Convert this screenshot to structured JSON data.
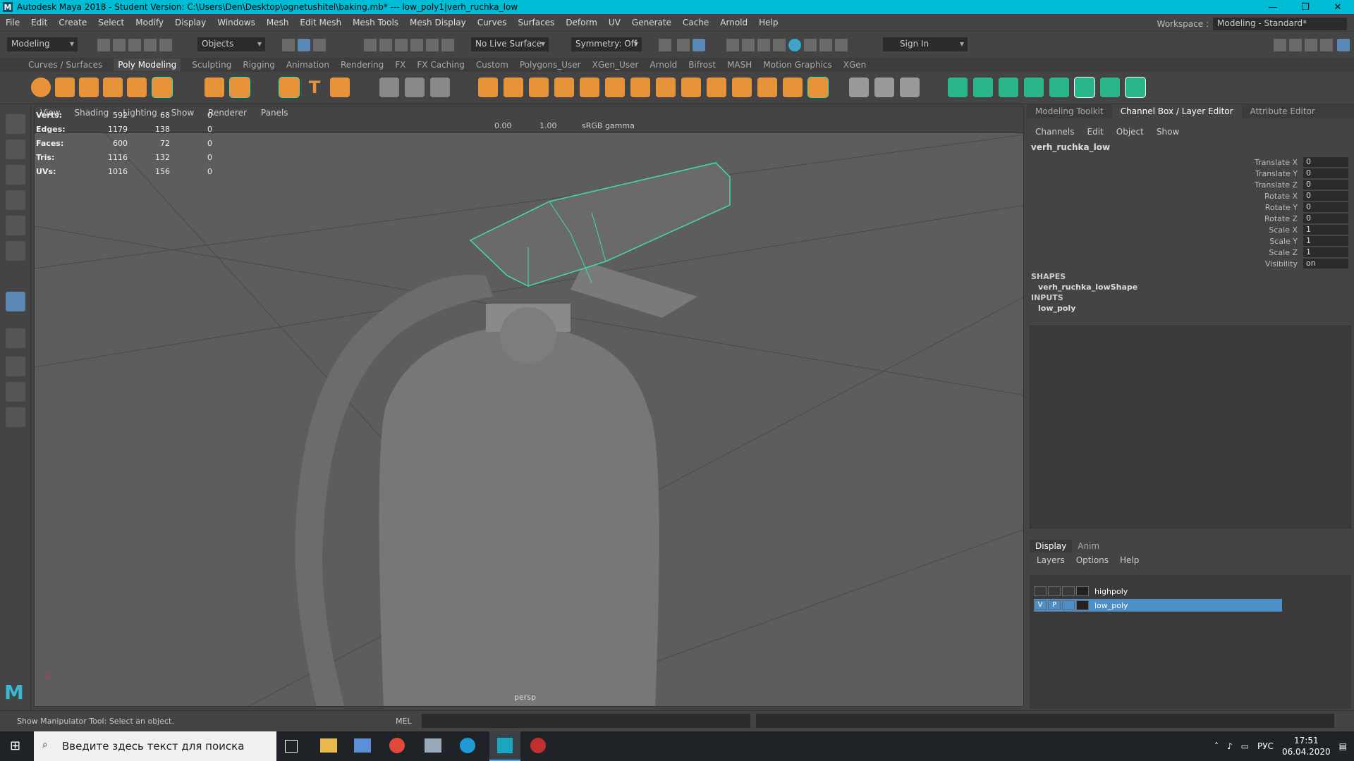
{
  "window": {
    "title": "Autodesk Maya 2018 - Student Version: C:\\Users\\Den\\Desktop\\ognetushitel\\baking.mb*   ---   low_poly1|verh_ruchka_low",
    "logo": "M",
    "controls": [
      "—",
      "❐",
      "✕"
    ]
  },
  "menu": [
    "File",
    "Edit",
    "Create",
    "Select",
    "Modify",
    "Display",
    "Windows",
    "Mesh",
    "Edit Mesh",
    "Mesh Tools",
    "Mesh Display",
    "Curves",
    "Surfaces",
    "Deform",
    "UV",
    "Generate",
    "Cache",
    "Arnold",
    "Help"
  ],
  "workspace": {
    "label": "Workspace :",
    "value": "Modeling - Standard*"
  },
  "statusline": {
    "mode": "Modeling",
    "select_mode": "Objects",
    "live_surface": "No Live Surface",
    "symmetry": "Symmetry: Off",
    "sign_in": "Sign In"
  },
  "shelf_tabs": [
    "Curves / Surfaces",
    "Poly Modeling",
    "Sculpting",
    "Rigging",
    "Animation",
    "Rendering",
    "FX",
    "FX Caching",
    "Custom",
    "Polygons_User",
    "XGen_User",
    "Arnold",
    "Bifrost",
    "MASH",
    "Motion Graphics",
    "XGen"
  ],
  "active_shelf": "Poly Modeling",
  "viewport": {
    "menu": [
      "View",
      "Shading",
      "Lighting",
      "Show",
      "Renderer",
      "Panels"
    ],
    "exposure": "0.00",
    "gamma": "1.00",
    "color_space": "sRGB gamma",
    "camera": "persp",
    "hud": [
      {
        "label": "Verts:",
        "a": "592",
        "b": "68",
        "c": "0"
      },
      {
        "label": "Edges:",
        "a": "1179",
        "b": "138",
        "c": "0"
      },
      {
        "label": "Faces:",
        "a": "600",
        "b": "72",
        "c": "0"
      },
      {
        "label": "Tris:",
        "a": "1116",
        "b": "132",
        "c": "0"
      },
      {
        "label": "UVs:",
        "a": "1016",
        "b": "156",
        "c": "0"
      }
    ]
  },
  "right_panel": {
    "tabs": [
      "Modeling Toolkit",
      "Channel Box / Layer Editor",
      "Attribute Editor"
    ],
    "active_tab": "Channel Box / Layer Editor",
    "channel_menu": [
      "Channels",
      "Edit",
      "Object",
      "Show"
    ],
    "object": "verh_ruchka_low",
    "attributes": [
      {
        "name": "Translate X",
        "value": "0"
      },
      {
        "name": "Translate Y",
        "value": "0"
      },
      {
        "name": "Translate Z",
        "value": "0"
      },
      {
        "name": "Rotate X",
        "value": "0"
      },
      {
        "name": "Rotate Y",
        "value": "0"
      },
      {
        "name": "Rotate Z",
        "value": "0"
      },
      {
        "name": "Scale X",
        "value": "1"
      },
      {
        "name": "Scale Y",
        "value": "1"
      },
      {
        "name": "Scale Z",
        "value": "1"
      },
      {
        "name": "Visibility",
        "value": "on"
      }
    ],
    "shapes_header": "SHAPES",
    "shape": "verh_ruchka_lowShape",
    "inputs_header": "INPUTS",
    "input": "low_poly",
    "layer_tabs": [
      "Display",
      "Anim"
    ],
    "layer_menu": [
      "Layers",
      "Options",
      "Help"
    ],
    "layers": [
      {
        "name": "highpoly",
        "v": "",
        "p": ""
      },
      {
        "name": "low_poly",
        "v": "V",
        "p": "P"
      }
    ]
  },
  "helpline": {
    "message": "Show Manipulator Tool: Select an object.",
    "mel": "MEL"
  },
  "taskbar": {
    "search_placeholder": "Введите здесь текст для поиска",
    "lang": "РУС",
    "time": "17:51",
    "date": "06.04.2020"
  },
  "colors": {
    "accent": "#00bcd4",
    "selection": "#4f8fc8",
    "wireframe": "#3fe0a0"
  }
}
